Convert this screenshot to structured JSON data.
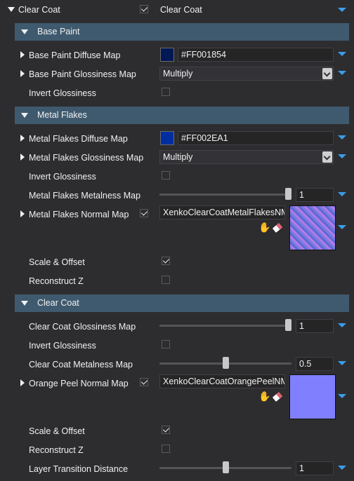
{
  "top": {
    "title": "Clear Coat",
    "checked": true,
    "value_label": "Clear Coat"
  },
  "sections": {
    "base_paint": "Base Paint",
    "metal_flakes": "Metal Flakes",
    "clear_coat": "Clear Coat"
  },
  "base_paint": {
    "diffuse_label": "Base Paint Diffuse Map",
    "diffuse_color": "#001854",
    "diffuse_value": "#FF001854",
    "gloss_label": "Base Paint Glossiness Map",
    "gloss_value": "Multiply",
    "invert_label": "Invert Glossiness",
    "invert_checked": false
  },
  "metal_flakes": {
    "diffuse_label": "Metal Flakes Diffuse Map",
    "diffuse_color": "#002EA1",
    "diffuse_value": "#FF002EA1",
    "gloss_label": "Metal Flakes Glossiness Map",
    "gloss_value": "Multiply",
    "invert_label": "Invert Glossiness",
    "invert_checked": false,
    "metalness_label": "Metal Flakes Metalness Map",
    "metalness_value": "1",
    "metalness_fraction": 1.0,
    "normal_label": "Metal Flakes Normal Map",
    "normal_checked": true,
    "normal_texture": "XenkoClearCoatMetalFlakesNM",
    "scale_label": "Scale & Offset",
    "scale_checked": true,
    "reconstruct_label": "Reconstruct Z",
    "reconstruct_checked": false
  },
  "clear_coat": {
    "gloss_label": "Clear Coat Glossiness Map",
    "gloss_value": "1",
    "gloss_fraction": 1.0,
    "invert_label": "Invert Glossiness",
    "invert_checked": false,
    "metalness_label": "Clear Coat Metalness Map",
    "metalness_value": "0.5",
    "metalness_fraction": 0.5,
    "orange_label": "Orange Peel Normal Map",
    "orange_checked": true,
    "orange_texture": "XenkoClearCoatOrangePeelNM",
    "scale_label": "Scale & Offset",
    "scale_checked": true,
    "reconstruct_label": "Reconstruct Z",
    "reconstruct_checked": false,
    "transition_label": "Layer Transition Distance",
    "transition_value": "1",
    "transition_fraction": 0.5
  },
  "icons": {
    "hand": "hand-pointer-icon",
    "eraser": "eraser-icon",
    "expand": "blue-chevron-down-icon"
  },
  "colors": {
    "accent": "#3a9ee8",
    "section_bg": "#3f5a6e",
    "background": "#2d2d30"
  }
}
